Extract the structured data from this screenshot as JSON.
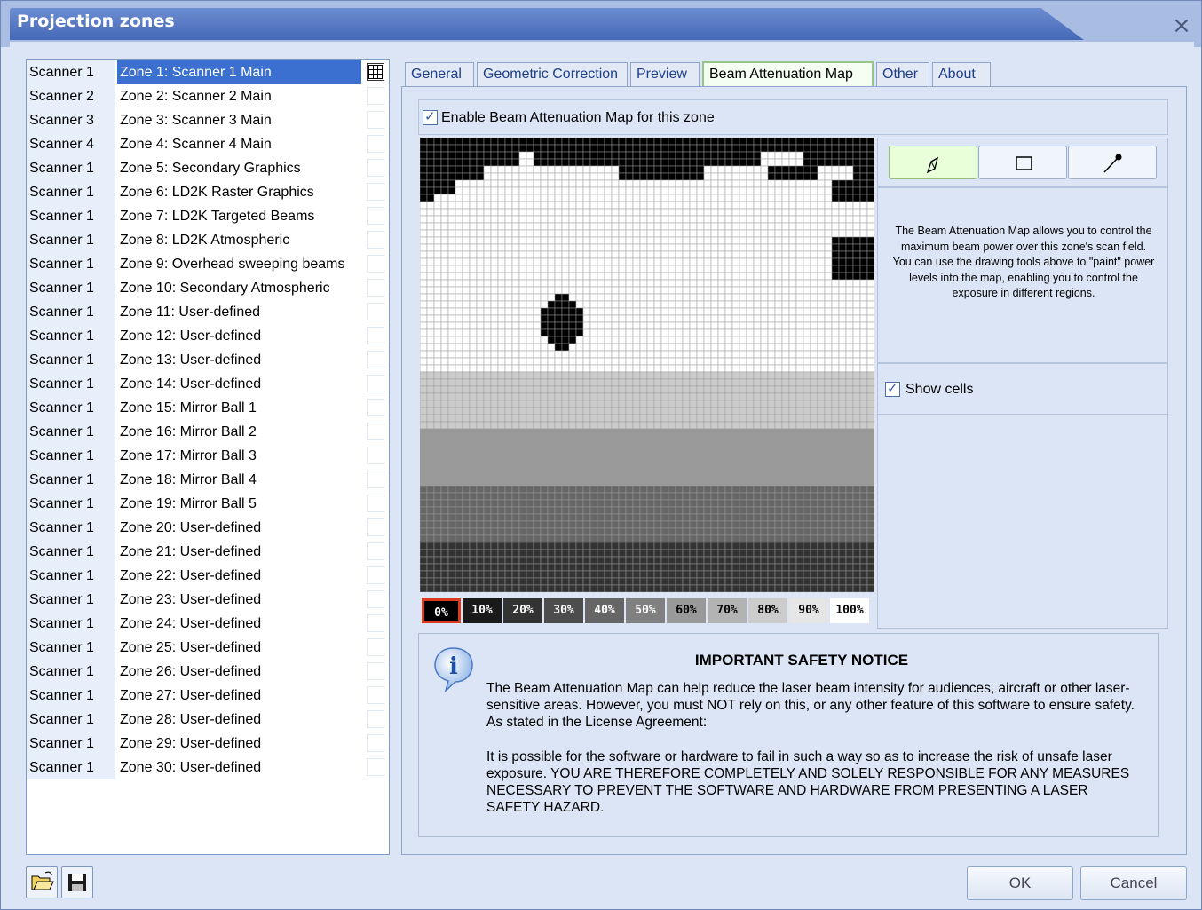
{
  "window": {
    "title": "Projection zones",
    "close_icon": "×"
  },
  "zones": [
    {
      "scanner": "Scanner 1",
      "name": "Zone 1: Scanner 1 Main",
      "selected": true
    },
    {
      "scanner": "Scanner 2",
      "name": "Zone 2: Scanner 2 Main"
    },
    {
      "scanner": "Scanner 3",
      "name": "Zone 3: Scanner 3 Main"
    },
    {
      "scanner": "Scanner 4",
      "name": "Zone 4: Scanner 4 Main"
    },
    {
      "scanner": "Scanner 1",
      "name": "Zone 5: Secondary Graphics"
    },
    {
      "scanner": "Scanner 1",
      "name": "Zone 6: LD2K Raster Graphics"
    },
    {
      "scanner": "Scanner 1",
      "name": "Zone 7: LD2K Targeted Beams"
    },
    {
      "scanner": "Scanner 1",
      "name": "Zone 8: LD2K Atmospheric"
    },
    {
      "scanner": "Scanner 1",
      "name": "Zone 9: Overhead sweeping beams"
    },
    {
      "scanner": "Scanner 1",
      "name": "Zone 10: Secondary Atmospheric"
    },
    {
      "scanner": "Scanner 1",
      "name": "Zone 11: User-defined"
    },
    {
      "scanner": "Scanner 1",
      "name": "Zone 12: User-defined"
    },
    {
      "scanner": "Scanner 1",
      "name": "Zone 13: User-defined"
    },
    {
      "scanner": "Scanner 1",
      "name": "Zone 14: User-defined"
    },
    {
      "scanner": "Scanner 1",
      "name": "Zone 15: Mirror Ball 1"
    },
    {
      "scanner": "Scanner 1",
      "name": "Zone 16: Mirror Ball 2"
    },
    {
      "scanner": "Scanner 1",
      "name": "Zone 17: Mirror Ball 3"
    },
    {
      "scanner": "Scanner 1",
      "name": "Zone 18: Mirror Ball 4"
    },
    {
      "scanner": "Scanner 1",
      "name": "Zone 19: Mirror Ball 5"
    },
    {
      "scanner": "Scanner 1",
      "name": "Zone 20: User-defined"
    },
    {
      "scanner": "Scanner 1",
      "name": "Zone 21: User-defined"
    },
    {
      "scanner": "Scanner 1",
      "name": "Zone 22: User-defined"
    },
    {
      "scanner": "Scanner 1",
      "name": "Zone 23: User-defined"
    },
    {
      "scanner": "Scanner 1",
      "name": "Zone 24: User-defined"
    },
    {
      "scanner": "Scanner 1",
      "name": "Zone 25: User-defined"
    },
    {
      "scanner": "Scanner 1",
      "name": "Zone 26: User-defined"
    },
    {
      "scanner": "Scanner 1",
      "name": "Zone 27: User-defined"
    },
    {
      "scanner": "Scanner 1",
      "name": "Zone 28: User-defined"
    },
    {
      "scanner": "Scanner 1",
      "name": "Zone 29: User-defined"
    },
    {
      "scanner": "Scanner 1",
      "name": "Zone 30: User-defined"
    }
  ],
  "tabs": [
    {
      "label": "General"
    },
    {
      "label": "Geometric Correction"
    },
    {
      "label": "Preview"
    },
    {
      "label": "Beam Attenuation Map",
      "active": true
    },
    {
      "label": "Other"
    },
    {
      "label": "About"
    }
  ],
  "map": {
    "enable_label": "Enable Beam Attenuation Map for this zone",
    "enabled": true,
    "tools": [
      "pencil-icon",
      "rectangle-icon",
      "eyedropper-icon"
    ],
    "active_tool": "pencil-icon",
    "info_text": "The Beam Attenuation Map allows you to control the maximum beam power over this zone's scan field. You can use the drawing tools above to \"paint\" power levels into the map, enabling you to control the exposure in different regions.",
    "show_cells_label": "Show cells",
    "show_cells": true,
    "palette": [
      {
        "label": "0%",
        "bg": "#000000",
        "fg": "#ffffff",
        "selected": true
      },
      {
        "label": "10%",
        "bg": "#1a1a1a",
        "fg": "#ffffff"
      },
      {
        "label": "20%",
        "bg": "#333333",
        "fg": "#ffffff"
      },
      {
        "label": "30%",
        "bg": "#4d4d4d",
        "fg": "#ffffff"
      },
      {
        "label": "40%",
        "bg": "#666666",
        "fg": "#ffffff"
      },
      {
        "label": "50%",
        "bg": "#808080",
        "fg": "#ffffff"
      },
      {
        "label": "60%",
        "bg": "#999999",
        "fg": "#000000"
      },
      {
        "label": "70%",
        "bg": "#b3b3b3",
        "fg": "#000000"
      },
      {
        "label": "80%",
        "bg": "#cccccc",
        "fg": "#000000"
      },
      {
        "label": "90%",
        "bg": "#e6e6e6",
        "fg": "#000000"
      },
      {
        "label": "100%",
        "bg": "#ffffff",
        "fg": "#000000"
      }
    ]
  },
  "safety": {
    "title": "IMPORTANT SAFETY NOTICE",
    "p1": "The Beam Attenuation Map can help reduce the laser beam intensity for audiences, aircraft or other laser-sensitive areas. However, you must NOT rely on this, or any other feature of this software to ensure safety. As stated in the License Agreement:",
    "p2": "It is possible for the software or hardware to fail in such a way so as to increase the risk of unsafe laser exposure. YOU ARE THEREFORE COMPLETELY AND SOLELY RESPONSIBLE FOR ANY MEASURES NECESSARY TO PREVENT THE SOFTWARE AND HARDWARE FROM PRESENTING A LASER SAFETY HAZARD."
  },
  "buttons": {
    "ok": "OK",
    "cancel": "Cancel"
  }
}
